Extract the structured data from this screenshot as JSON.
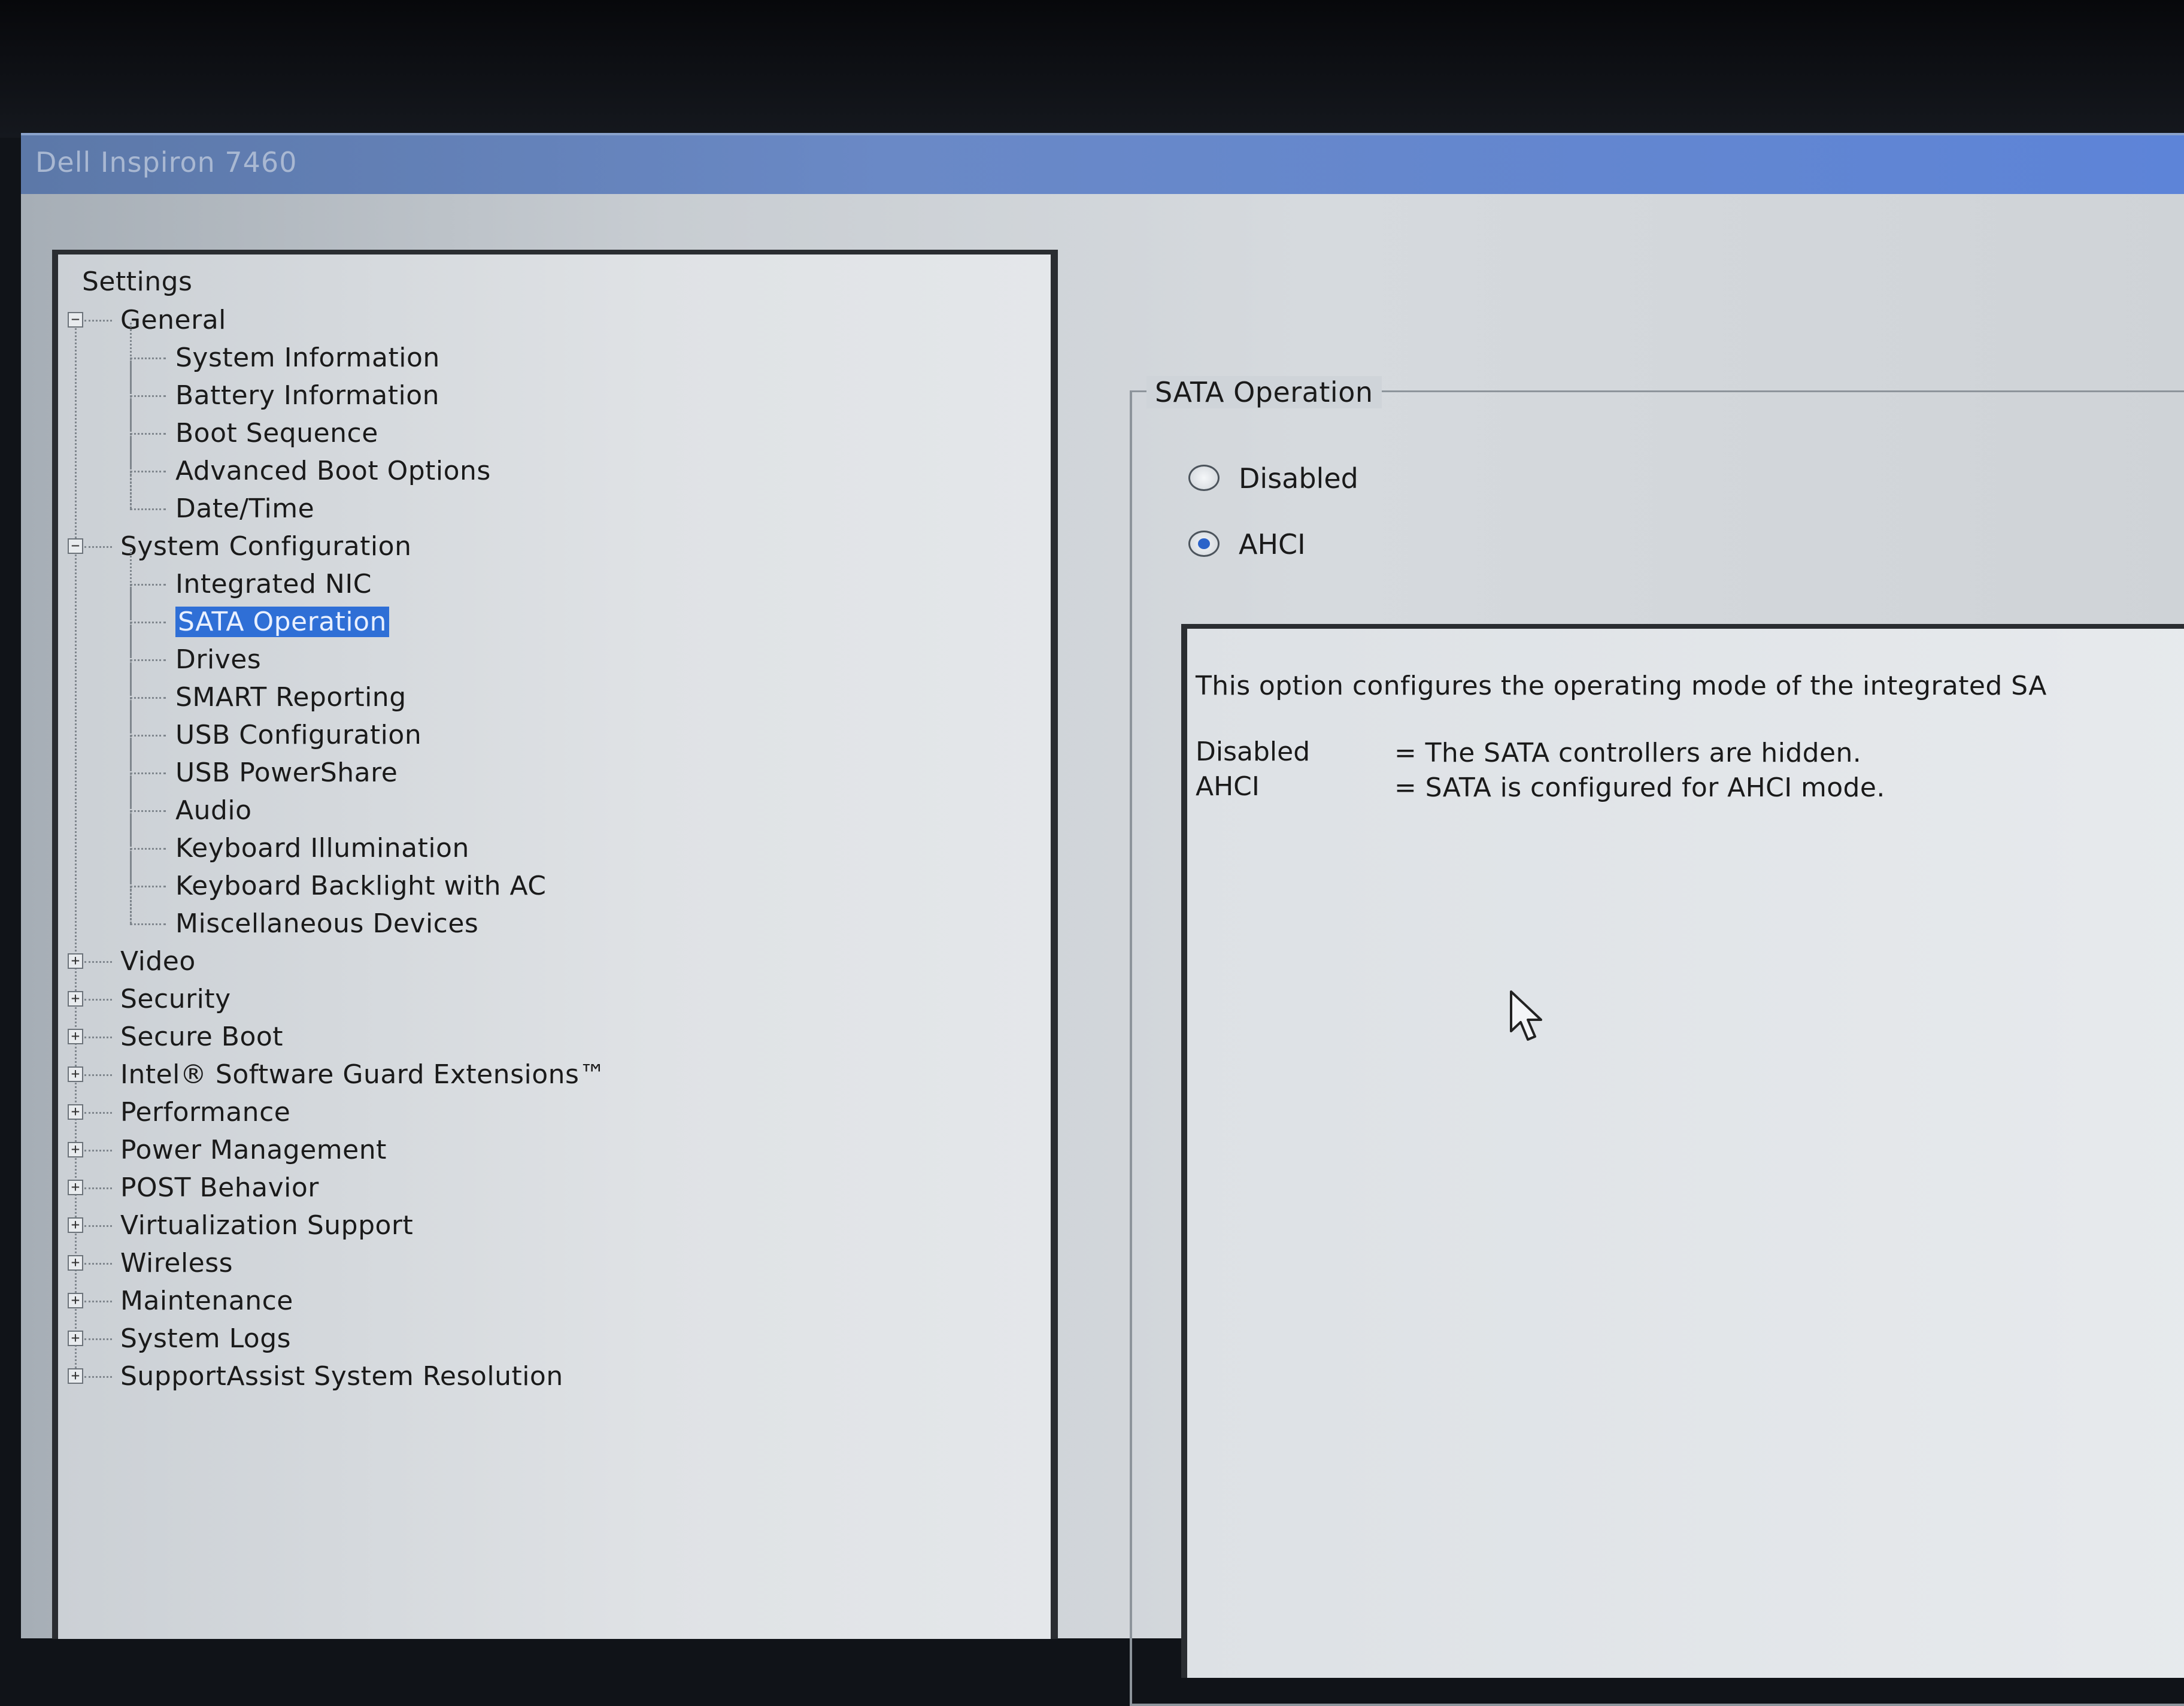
{
  "window": {
    "title": "Dell Inspiron 7460"
  },
  "tree": {
    "root": "Settings",
    "items": [
      {
        "label": "General",
        "level": 1,
        "expander": "⊟"
      },
      {
        "label": "System Information",
        "level": 2
      },
      {
        "label": "Battery Information",
        "level": 2
      },
      {
        "label": "Boot Sequence",
        "level": 2
      },
      {
        "label": "Advanced Boot Options",
        "level": 2
      },
      {
        "label": "Date/Time",
        "level": 2
      },
      {
        "label": "System Configuration",
        "level": 1,
        "expander": "⊟"
      },
      {
        "label": "Integrated NIC",
        "level": 2
      },
      {
        "label": "SATA Operation",
        "level": 2,
        "selected": true
      },
      {
        "label": "Drives",
        "level": 2
      },
      {
        "label": "SMART Reporting",
        "level": 2
      },
      {
        "label": "USB Configuration",
        "level": 2
      },
      {
        "label": "USB PowerShare",
        "level": 2
      },
      {
        "label": "Audio",
        "level": 2
      },
      {
        "label": "Keyboard Illumination",
        "level": 2
      },
      {
        "label": "Keyboard Backlight with AC",
        "level": 2
      },
      {
        "label": "Miscellaneous Devices",
        "level": 2
      },
      {
        "label": "Video",
        "level": 1,
        "expander": "⊞"
      },
      {
        "label": "Security",
        "level": 1,
        "expander": "⊞"
      },
      {
        "label": "Secure Boot",
        "level": 1,
        "expander": "⊞"
      },
      {
        "label": "Intel® Software Guard Extensions™",
        "level": 1,
        "expander": "⊞"
      },
      {
        "label": "Performance",
        "level": 1,
        "expander": "⊞"
      },
      {
        "label": "Power Management",
        "level": 1,
        "expander": "⊞"
      },
      {
        "label": "POST Behavior",
        "level": 1,
        "expander": "⊞"
      },
      {
        "label": "Virtualization Support",
        "level": 1,
        "expander": "⊞"
      },
      {
        "label": "Wireless",
        "level": 1,
        "expander": "⊞"
      },
      {
        "label": "Maintenance",
        "level": 1,
        "expander": "⊞"
      },
      {
        "label": "System Logs",
        "level": 1,
        "expander": "⊞"
      },
      {
        "label": "SupportAssist System Resolution",
        "level": 1,
        "expander": "⊞"
      }
    ]
  },
  "detail": {
    "group_title": "SATA Operation",
    "options": [
      {
        "label": "Disabled",
        "checked": false
      },
      {
        "label": "AHCI",
        "checked": true
      }
    ],
    "description": "This option configures the operating mode of the integrated SA",
    "legend": [
      {
        "key": "Disabled",
        "value": "= The SATA controllers are hidden."
      },
      {
        "key": "AHCI",
        "value": "= SATA is configured for AHCI mode."
      }
    ]
  },
  "colors": {
    "selection": "#2f6fd6",
    "titlebar": "#6a89c6",
    "radio_dot": "#2b63c9"
  },
  "icons": {
    "cursor": "mouse-pointer-icon"
  }
}
